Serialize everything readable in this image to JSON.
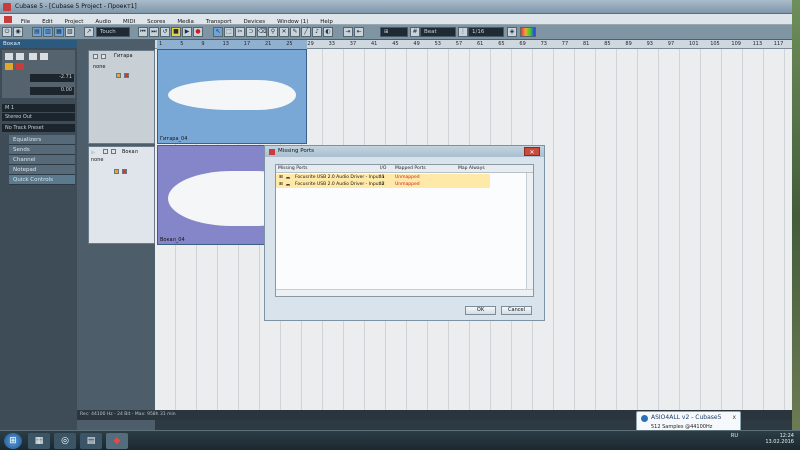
{
  "window": {
    "title": "Cubase 5 - [Cubase 5 Project - Проект1]",
    "menu": [
      "File",
      "Edit",
      "Project",
      "Audio",
      "MIDI",
      "Scores",
      "Media",
      "Transport",
      "Devices",
      "Window (1)",
      "Help"
    ]
  },
  "toolbar": {
    "automation_mode": "Touch",
    "snap_type": "Beat",
    "quantize": "1/16"
  },
  "inspector": {
    "title": "Вокал",
    "val1": "-2.71",
    "val2": "0.00",
    "input_routing": "M 1",
    "output_routing": "Stereo Out",
    "preset": "No Track Preset",
    "sections": [
      "Equalizers",
      "Sends",
      "Channel",
      "Notepad",
      "Quick Controls"
    ]
  },
  "tracks": [
    {
      "name": "Гитара",
      "state": "none"
    },
    {
      "name": "Вокал",
      "state": "none"
    }
  ],
  "ruler": {
    "labels": [
      "1",
      "5",
      "9",
      "13",
      "17",
      "21",
      "25",
      "29",
      "33",
      "37",
      "41",
      "45",
      "49",
      "53",
      "57",
      "61",
      "65",
      "69",
      "73",
      "77",
      "81",
      "85",
      "89",
      "93",
      "97",
      "101",
      "105",
      "109",
      "113",
      "117"
    ]
  },
  "clips": [
    {
      "name": "Гитара_04"
    },
    {
      "name": "Вокал_04"
    }
  ],
  "status": {
    "text": "Rec: 44100 Hz - 24 Bit - Max: 958h 31 min"
  },
  "dialog": {
    "title": "Missing Ports",
    "columns": [
      "Missing Ports",
      "I/O",
      "Mapped Ports",
      "Map Always"
    ],
    "rows": [
      {
        "port": "Focusrite USB 2.0 Audio Driver - Input 1",
        "io": "In",
        "mapped": "Unmapped"
      },
      {
        "port": "Focusrite USB 2.0 Audio Driver - Input 2",
        "io": "In",
        "mapped": "Unmapped"
      }
    ],
    "ok": "OK",
    "cancel": "Cancel"
  },
  "notification": {
    "title": "ASIO4ALL v2 - Cubase5",
    "subtitle": "512 Samples @44100Hz",
    "close": "x"
  },
  "taskbar": {
    "lang": "RU",
    "time": "12:24",
    "date": "13.02.2016"
  }
}
